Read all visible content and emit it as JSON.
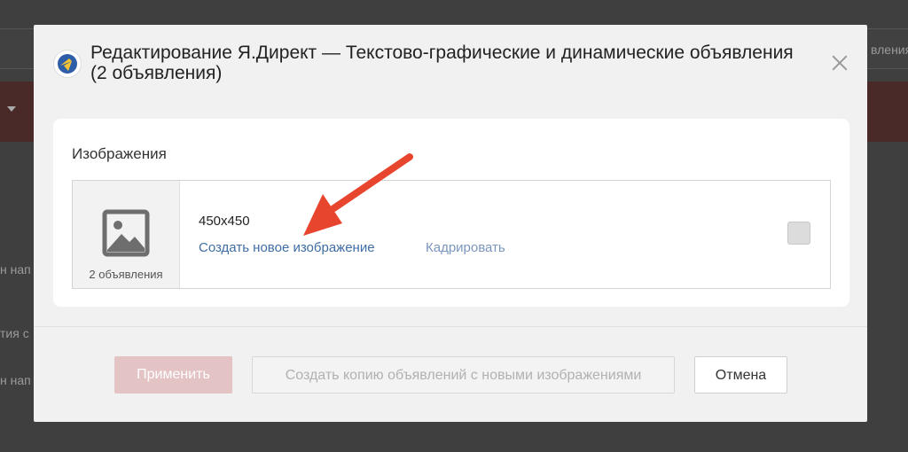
{
  "background": {
    "fragments": [
      "н нап",
      "тия с",
      "н нап",
      "вления"
    ]
  },
  "modal": {
    "title": "Редактирование Я.Директ — Текстово-графические и динамические объявления (2 объявления)",
    "logo_icon": "yandex-direct-logo-icon",
    "close_icon": "close-icon",
    "section_title": "Изображения",
    "image": {
      "placeholder_icon": "image-placeholder-icon",
      "caption": "2 объявления",
      "size": "450x450",
      "create_link": "Создать новое изображение",
      "crop_link": "Кадрировать",
      "checked": false
    },
    "buttons": {
      "apply": "Применить",
      "copy": "Создать копию объявлений с новыми изображениями",
      "cancel": "Отмена"
    }
  },
  "annotation": {
    "arrow_color": "#e8452f"
  },
  "colors": {
    "link": "#3f6ea5",
    "apply_disabled": "#e3c3c3",
    "overlay": "#3f3f3f"
  }
}
